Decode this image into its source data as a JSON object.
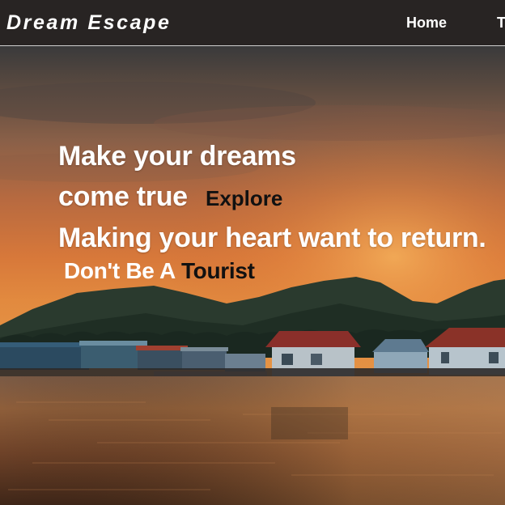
{
  "nav": {
    "brand": "Dream Escape",
    "links": [
      {
        "label": "Home"
      },
      {
        "label": "T"
      }
    ]
  },
  "hero": {
    "line1": "Make your dreams",
    "line2": "come true",
    "explore": "Explore",
    "line3": "Making your heart want to return.",
    "tagline_main": "Don't Be A",
    "tagline_accent": "Tourist"
  },
  "colors": {
    "navbar_bg": "#282423",
    "headline_text": "#ffffff",
    "accent_text": "#111111",
    "sky_top": "#3b3a3a",
    "sky_glow": "#d9783a",
    "water": "#8a5a34"
  }
}
